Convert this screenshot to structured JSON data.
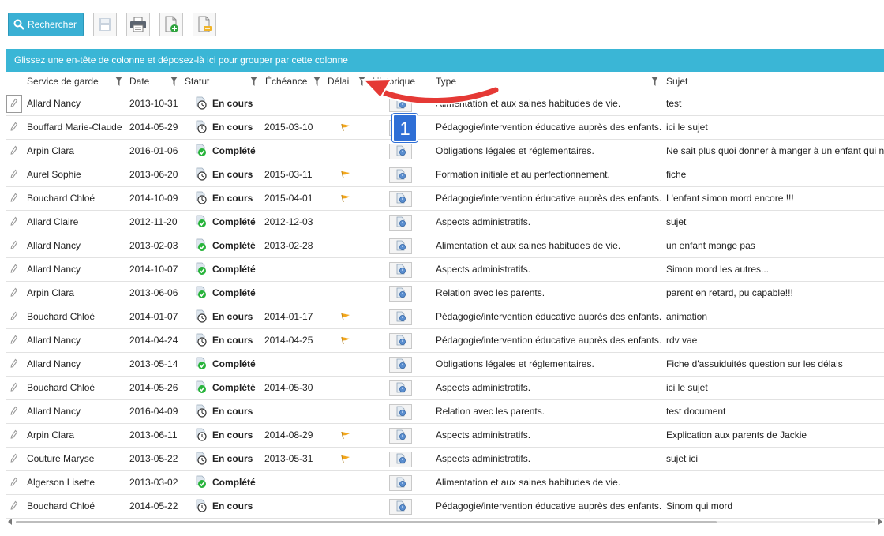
{
  "toolbar": {
    "search_label": "Rechercher",
    "icons": [
      "save-icon",
      "print-icon",
      "add-document-icon",
      "export-document-icon"
    ]
  },
  "group_panel": {
    "text": "Glissez une en-tête de colonne et déposez-là ici pour grouper par cette colonne"
  },
  "columns": {
    "service": "Service de garde",
    "date": "Date",
    "statut": "Statut",
    "echeance": "Échéance",
    "delai": "Délai",
    "historique": "Historique",
    "type": "Type",
    "sujet": "Sujet"
  },
  "annotation": {
    "badge": "1"
  },
  "colors": {
    "accent": "#3ab6d6",
    "annotation_red": "#e53935",
    "badge_blue": "#2f6fd6",
    "complete_green": "#27b33a",
    "flag_orange": "#f3a71c"
  },
  "rows": [
    {
      "service": "Allard Nancy",
      "date": "2013-10-31",
      "status": "en-cours",
      "statut": "En cours",
      "echeance": "",
      "delai": false,
      "type": "Alimentation et aux saines habitudes de vie.",
      "sujet": "test"
    },
    {
      "service": "Bouffard Marie-Claude",
      "date": "2014-05-29",
      "status": "en-cours",
      "statut": "En cours",
      "echeance": "2015-03-10",
      "delai": true,
      "type": "Pédagogie/intervention éducative auprès des enfants.",
      "sujet": "ici le sujet"
    },
    {
      "service": "Arpin Clara",
      "date": "2016-01-06",
      "status": "complete",
      "statut": "Complété",
      "echeance": "",
      "delai": false,
      "type": "Obligations légales et réglementaires.",
      "sujet": "Ne sait plus quoi donner à manger à un enfant qui ne"
    },
    {
      "service": "Aurel Sophie",
      "date": "2013-06-20",
      "status": "en-cours",
      "statut": "En cours",
      "echeance": "2015-03-11",
      "delai": true,
      "type": "Formation initiale et au perfectionnement.",
      "sujet": "fiche"
    },
    {
      "service": "Bouchard Chloé",
      "date": "2014-10-09",
      "status": "en-cours",
      "statut": "En cours",
      "echeance": "2015-04-01",
      "delai": true,
      "type": "Pédagogie/intervention éducative auprès des enfants.",
      "sujet": "L'enfant simon mord encore !!!"
    },
    {
      "service": "Allard Claire",
      "date": "2012-11-20",
      "status": "complete",
      "statut": "Complété",
      "echeance": "2012-12-03",
      "delai": false,
      "type": "Aspects administratifs.",
      "sujet": "sujet"
    },
    {
      "service": "Allard Nancy",
      "date": "2013-02-03",
      "status": "complete",
      "statut": "Complété",
      "echeance": "2013-02-28",
      "delai": false,
      "type": "Alimentation et aux saines habitudes de vie.",
      "sujet": "un enfant mange pas"
    },
    {
      "service": "Allard Nancy",
      "date": "2014-10-07",
      "status": "complete",
      "statut": "Complété",
      "echeance": "",
      "delai": false,
      "type": "Aspects administratifs.",
      "sujet": "Simon mord les autres..."
    },
    {
      "service": "Arpin Clara",
      "date": "2013-06-06",
      "status": "complete",
      "statut": "Complété",
      "echeance": "",
      "delai": false,
      "type": "Relation avec les parents.",
      "sujet": "parent en retard, pu capable!!!"
    },
    {
      "service": "Bouchard Chloé",
      "date": "2014-01-07",
      "status": "en-cours",
      "statut": "En cours",
      "echeance": "2014-01-17",
      "delai": true,
      "type": "Pédagogie/intervention éducative auprès des enfants.",
      "sujet": "animation"
    },
    {
      "service": "Allard Nancy",
      "date": "2014-04-24",
      "status": "en-cours",
      "statut": "En cours",
      "echeance": "2014-04-25",
      "delai": true,
      "type": "Pédagogie/intervention éducative auprès des enfants.",
      "sujet": "rdv vae"
    },
    {
      "service": "Allard Nancy",
      "date": "2013-05-14",
      "status": "complete",
      "statut": "Complété",
      "echeance": "",
      "delai": false,
      "type": "Obligations légales et réglementaires.",
      "sujet": "Fiche d'assuiduités question sur les délais"
    },
    {
      "service": "Bouchard Chloé",
      "date": "2014-05-26",
      "status": "complete",
      "statut": "Complété",
      "echeance": "2014-05-30",
      "delai": false,
      "type": "Aspects administratifs.",
      "sujet": "ici le sujet"
    },
    {
      "service": "Allard Nancy",
      "date": "2016-04-09",
      "status": "en-cours",
      "statut": "En cours",
      "echeance": "",
      "delai": false,
      "type": "Relation avec les parents.",
      "sujet": "test document"
    },
    {
      "service": "Arpin Clara",
      "date": "2013-06-11",
      "status": "en-cours",
      "statut": "En cours",
      "echeance": "2014-08-29",
      "delai": true,
      "type": "Aspects administratifs.",
      "sujet": "Explication aux parents de Jackie"
    },
    {
      "service": "Couture Maryse",
      "date": "2013-05-22",
      "status": "en-cours",
      "statut": "En cours",
      "echeance": "2013-05-31",
      "delai": true,
      "type": "Aspects administratifs.",
      "sujet": "sujet ici"
    },
    {
      "service": "Algerson Lisette",
      "date": "2013-03-02",
      "status": "complete",
      "statut": "Complété",
      "echeance": "",
      "delai": false,
      "type": "Alimentation et aux saines habitudes de vie.",
      "sujet": ""
    },
    {
      "service": "Bouchard Chloé",
      "date": "2014-05-22",
      "status": "en-cours",
      "statut": "En cours",
      "echeance": "",
      "delai": false,
      "type": "Pédagogie/intervention éducative auprès des enfants.",
      "sujet": "Sinom qui mord"
    }
  ]
}
